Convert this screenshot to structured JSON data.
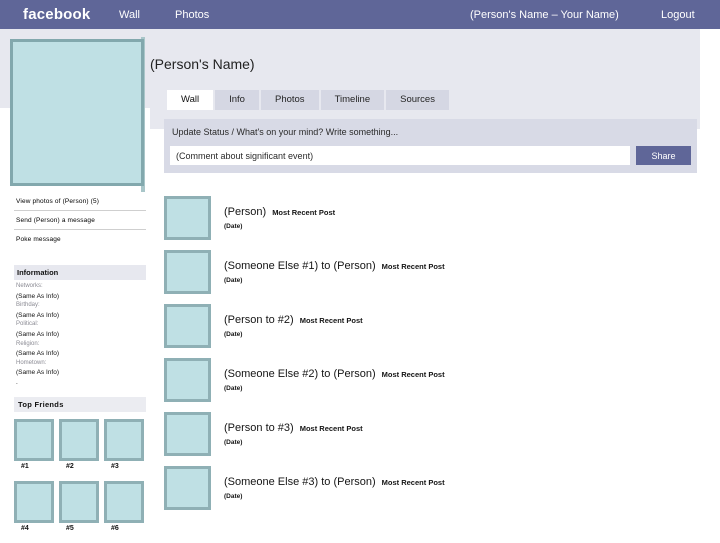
{
  "topbar": {
    "brand": "facebook",
    "nav": [
      {
        "label": "Wall",
        "name": "nav-wall"
      },
      {
        "label": "Photos",
        "name": "nav-photos"
      }
    ],
    "user_label": "(Person's Name – Your Name)",
    "logout_label": "Logout",
    "background_color": "#5f6698",
    "text_color": "#ffffff"
  },
  "profile": {
    "name": "(Person's Name)",
    "photo_alt": "profile-photo-placeholder",
    "photo_fill_color": "#bfe0e4",
    "photo_border_color": "#82a8ad"
  },
  "tabs": [
    {
      "label": "Wall",
      "active": true
    },
    {
      "label": "Info",
      "active": false
    },
    {
      "label": "Photos",
      "active": false
    },
    {
      "label": "Timeline",
      "active": false
    },
    {
      "label": "Sources",
      "active": false
    }
  ],
  "status": {
    "prompt": "Update Status / What's on your mind?  Write something...",
    "input_value": "(Comment about significant event)",
    "input_placeholder": "(Comment about significant event)",
    "share_label": "Share",
    "share_color": "#5f6698",
    "panel_color": "#d8dae6"
  },
  "sidebar": {
    "links": [
      "View photos of (Person) (5)",
      "Send (Person) a message",
      "Poke message"
    ],
    "information": {
      "heading": "Information",
      "rows": [
        {
          "key": "Networks:",
          "value": "(Same As Info)"
        },
        {
          "key": "Birthday:",
          "value": "(Same As Info)"
        },
        {
          "key": "Political:",
          "value": "(Same As Info)"
        },
        {
          "key": "Religion:",
          "value": "(Same As Info)"
        },
        {
          "key": "Hometown:",
          "value": "(Same As Info)"
        }
      ],
      "trailing": "."
    },
    "top_friends": {
      "heading": "Top Friends",
      "items": [
        {
          "label": "#1"
        },
        {
          "label": "#2"
        },
        {
          "label": "#3"
        },
        {
          "label": "#4"
        },
        {
          "label": "#5"
        },
        {
          "label": "#6"
        }
      ]
    }
  },
  "feed": {
    "posts": [
      {
        "author": "(Person)",
        "tag": "Most Recent Post",
        "date": "(Date)"
      },
      {
        "author": "(Someone Else #1) to (Person)",
        "tag": "Most Recent Post",
        "date": "(Date)"
      },
      {
        "author": "(Person to #2)",
        "tag": "Most Recent Post",
        "date": "(Date)"
      },
      {
        "author": "(Someone Else #2) to (Person)",
        "tag": "Most Recent Post",
        "date": "(Date)"
      },
      {
        "author": "(Person to #3)",
        "tag": "Most Recent Post",
        "date": "(Date)"
      },
      {
        "author": "(Someone Else #3) to (Person)",
        "tag": "Most Recent Post",
        "date": "(Date)"
      }
    ]
  }
}
